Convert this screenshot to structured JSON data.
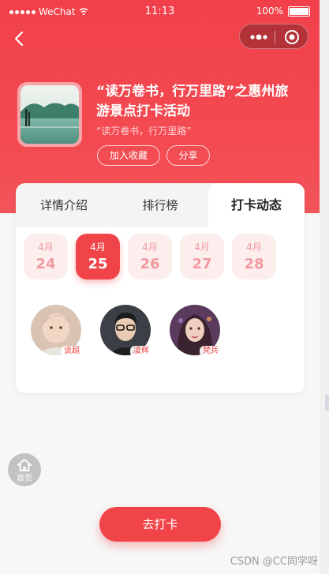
{
  "status_bar": {
    "carrier": "WeChat",
    "time": "11:13",
    "battery": "100%"
  },
  "header": {
    "back_icon": "chevron-left-icon",
    "capsule": {
      "more_icon": "more-dots-icon",
      "close_icon": "target-icon"
    }
  },
  "activity": {
    "title": "“读万卷书，行万里路”之惠州旅游景点打卡活动",
    "subtitle": "“读万卷书，行万里路”",
    "favorite_label": "加入收藏",
    "share_label": "分享"
  },
  "tabs": [
    {
      "label": "详情介绍",
      "active": false
    },
    {
      "label": "排行榜",
      "active": false
    },
    {
      "label": "打卡动态",
      "active": true
    }
  ],
  "dates": [
    {
      "month": "4月",
      "day": "24",
      "selected": false
    },
    {
      "month": "4月",
      "day": "25",
      "selected": true
    },
    {
      "month": "4月",
      "day": "26",
      "selected": false
    },
    {
      "month": "4月",
      "day": "27",
      "selected": false
    },
    {
      "month": "4月",
      "day": "28",
      "selected": false
    }
  ],
  "users": [
    {
      "name": "谈超"
    },
    {
      "name": "凌辉"
    },
    {
      "name": "梵兵"
    }
  ],
  "home": {
    "label": "首页",
    "icon": "home-icon"
  },
  "cta": {
    "label": "去打卡"
  },
  "watermark": "CSDN @CC同学呀",
  "colors": {
    "brand_red": "#f14449",
    "date_bg": "#fdeeee",
    "date_text": "#f19aa0"
  }
}
